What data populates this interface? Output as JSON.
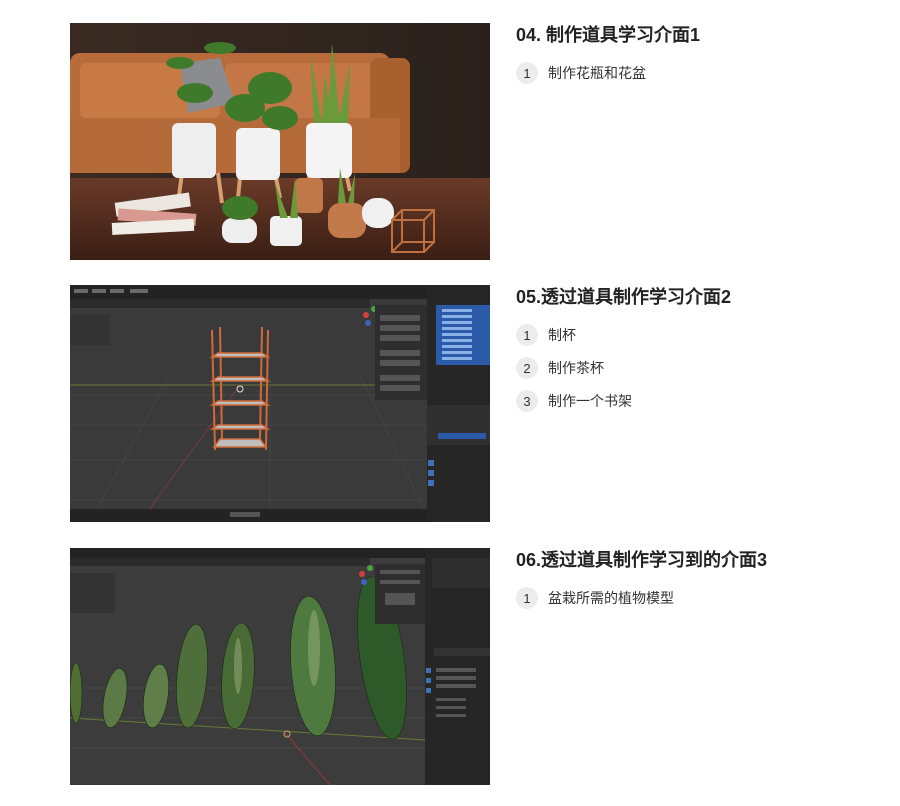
{
  "lessons": [
    {
      "title": "04. 制作道具学习介面1",
      "thumbnail": "rendered-plant-scene",
      "items": [
        {
          "num": "1",
          "label": "制作花瓶和花盆"
        }
      ]
    },
    {
      "title": "05.透过道具制作学习介面2",
      "thumbnail": "blender-shelf-viewport",
      "items": [
        {
          "num": "1",
          "label": "制杯"
        },
        {
          "num": "2",
          "label": "制作茶杯"
        },
        {
          "num": "3",
          "label": "制作一个书架"
        }
      ]
    },
    {
      "title": "06.透过道具制作学习到的介面3",
      "thumbnail": "blender-leaves-viewport",
      "items": [
        {
          "num": "1",
          "label": "盆栽所需的植物模型"
        }
      ]
    }
  ],
  "colors": {
    "blender_bg": "#3a3a3a",
    "blender_panel": "#2b2b2b",
    "blender_select": "#2a5aa8",
    "shelf_orange": "#d06a3a",
    "sofa": "#c87a45"
  }
}
